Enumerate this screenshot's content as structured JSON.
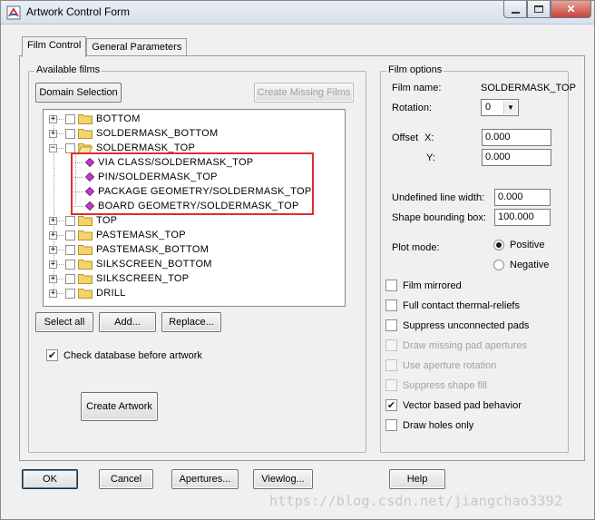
{
  "window": {
    "title": "Artwork Control Form",
    "icon": "artwork-app-icon"
  },
  "tabs": [
    {
      "label": "Film Control",
      "active": true
    },
    {
      "label": "General Parameters",
      "active": false
    }
  ],
  "available_films": {
    "group_label": "Available films",
    "domain_selection_label": "Domain Selection",
    "create_missing_label": "Create Missing Films",
    "tree": [
      {
        "label": "BOTTOM",
        "type": "folder",
        "expanded": false
      },
      {
        "label": "SOLDERMASK_BOTTOM",
        "type": "folder",
        "expanded": false
      },
      {
        "label": "SOLDERMASK_TOP",
        "type": "folder",
        "expanded": true
      },
      {
        "label": "VIA CLASS/SOLDERMASK_TOP",
        "type": "leaf"
      },
      {
        "label": "PIN/SOLDERMASK_TOP",
        "type": "leaf"
      },
      {
        "label": "PACKAGE GEOMETRY/SOLDERMASK_TOP",
        "type": "leaf"
      },
      {
        "label": "BOARD GEOMETRY/SOLDERMASK_TOP",
        "type": "leaf"
      },
      {
        "label": "TOP",
        "type": "folder",
        "expanded": false
      },
      {
        "label": "PASTEMASK_TOP",
        "type": "folder",
        "expanded": false
      },
      {
        "label": "PASTEMASK_BOTTOM",
        "type": "folder",
        "expanded": false
      },
      {
        "label": "SILKSCREEN_BOTTOM",
        "type": "folder",
        "expanded": false
      },
      {
        "label": "SILKSCREEN_TOP",
        "type": "folder",
        "expanded": false
      },
      {
        "label": "DRILL",
        "type": "folder",
        "expanded": false
      }
    ],
    "select_all_label": "Select all",
    "add_label": "Add...",
    "replace_label": "Replace...",
    "check_db_label": "Check database before artwork",
    "check_db_checked": true,
    "create_artwork_label": "Create Artwork"
  },
  "film_options": {
    "group_label": "Film options",
    "film_name_label": "Film name:",
    "film_name_value": "SOLDERMASK_TOP",
    "rotation_label": "Rotation:",
    "rotation_value": "0",
    "offset_label": "Offset",
    "x_label": "X:",
    "x_value": "0.000",
    "y_label": "Y:",
    "y_value": "0.000",
    "undefined_line_width_label": "Undefined line width:",
    "undefined_line_width_value": "0.000",
    "shape_bounding_box_label": "Shape bounding box:",
    "shape_bounding_box_value": "100.000",
    "plot_mode_label": "Plot mode:",
    "positive_label": "Positive",
    "negative_label": "Negative",
    "plot_mode_selected": "Positive",
    "checkboxes": [
      {
        "label": "Film mirrored",
        "checked": false,
        "enabled": true
      },
      {
        "label": "Full contact thermal-reliefs",
        "checked": false,
        "enabled": true
      },
      {
        "label": "Suppress unconnected pads",
        "checked": false,
        "enabled": true
      },
      {
        "label": "Draw missing pad apertures",
        "checked": false,
        "enabled": false
      },
      {
        "label": "Use aperture rotation",
        "checked": false,
        "enabled": false
      },
      {
        "label": "Suppress shape fill",
        "checked": false,
        "enabled": false
      },
      {
        "label": "Vector based pad behavior",
        "checked": true,
        "enabled": true
      },
      {
        "label": "Draw holes only",
        "checked": false,
        "enabled": true
      }
    ]
  },
  "bottom_buttons": {
    "ok": "OK",
    "cancel": "Cancel",
    "apertures": "Apertures...",
    "viewlog": "Viewlog...",
    "help": "Help"
  },
  "watermark": "https://blog.csdn.net/jiangchao3392",
  "colors": {
    "highlight_box": "#e32b2b",
    "folder": "#f5d36b",
    "leaf_gem": "#c03cc8"
  }
}
